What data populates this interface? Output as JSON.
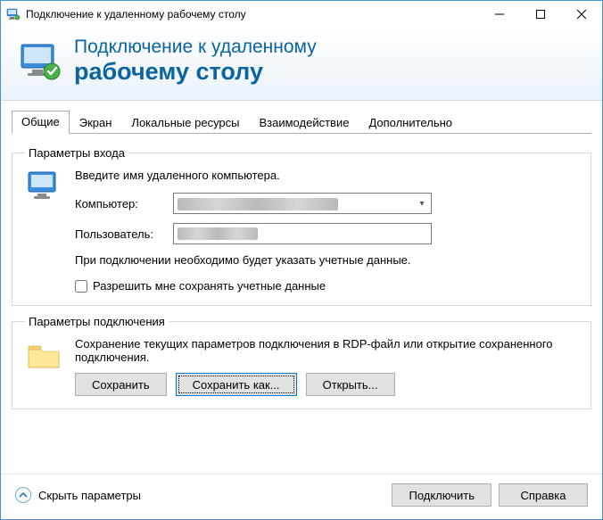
{
  "titlebar": {
    "title": "Подключение к удаленному рабочему столу"
  },
  "header": {
    "line1": "Подключение к удаленному",
    "line2": "рабочему столу"
  },
  "tabs": [
    {
      "label": "Общие",
      "active": true
    },
    {
      "label": "Экран",
      "active": false
    },
    {
      "label": "Локальные ресурсы",
      "active": false
    },
    {
      "label": "Взаимодействие",
      "active": false
    },
    {
      "label": "Дополнительно",
      "active": false
    }
  ],
  "login_group": {
    "legend": "Параметры входа",
    "hint": "Введите имя удаленного компьютера.",
    "computer_label": "Компьютер:",
    "computer_value": "",
    "user_label": "Пользователь:",
    "user_value": "",
    "note": "При подключении необходимо будет указать учетные данные.",
    "remember_label": "Разрешить мне сохранять учетные данные"
  },
  "conn_group": {
    "legend": "Параметры подключения",
    "hint": "Сохранение текущих параметров подключения в RDP-файл или открытие сохраненного подключения.",
    "save": "Сохранить",
    "save_as": "Сохранить как...",
    "open": "Открыть..."
  },
  "footer": {
    "toggle": "Скрыть параметры",
    "connect": "Подключить",
    "help": "Справка"
  }
}
